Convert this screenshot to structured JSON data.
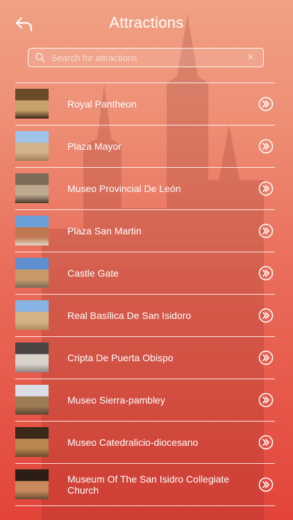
{
  "header": {
    "title": "Attractions",
    "back_icon": "back-arrow-icon"
  },
  "search": {
    "placeholder": "Search for attractions",
    "value": "",
    "clear_label": "✕"
  },
  "attractions": [
    {
      "name": "Royal Pantheon",
      "thumb_colors": [
        "#6b4a2a",
        "#c9a26a",
        "#3a2616"
      ]
    },
    {
      "name": "Plaza Mayor",
      "thumb_colors": [
        "#9fc3e8",
        "#d2b28a",
        "#a47f57"
      ]
    },
    {
      "name": "Museo Provincial De León",
      "thumb_colors": [
        "#7d6c58",
        "#bca98f",
        "#4a3a2b"
      ]
    },
    {
      "name": "Plaza San Martin",
      "thumb_colors": [
        "#6a9fd8",
        "#c07850",
        "#e0d8c8"
      ]
    },
    {
      "name": "Castle Gate",
      "thumb_colors": [
        "#5e8fd0",
        "#c89a6a",
        "#7a6a5a"
      ]
    },
    {
      "name": "Real Basílica De San Isidoro",
      "thumb_colors": [
        "#86b3e3",
        "#d6b487",
        "#b08a5c"
      ]
    },
    {
      "name": "Cripta De Puerta Obispo",
      "thumb_colors": [
        "#4a4444",
        "#d8d4cc",
        "#8c8480"
      ]
    },
    {
      "name": "Museo Sierra-pambley",
      "thumb_colors": [
        "#d8dde6",
        "#9c7b55",
        "#5a4430"
      ]
    },
    {
      "name": "Museo Catedralicio-diocesano",
      "thumb_colors": [
        "#3a2818",
        "#b8864f",
        "#6a4a2c"
      ]
    },
    {
      "name": "Museum Of The San Isidro Collegiate Church",
      "thumb_colors": [
        "#2a1e16",
        "#c88a5c",
        "#6a4c36"
      ]
    }
  ],
  "row_action_icon": "double-chevron-right-icon"
}
